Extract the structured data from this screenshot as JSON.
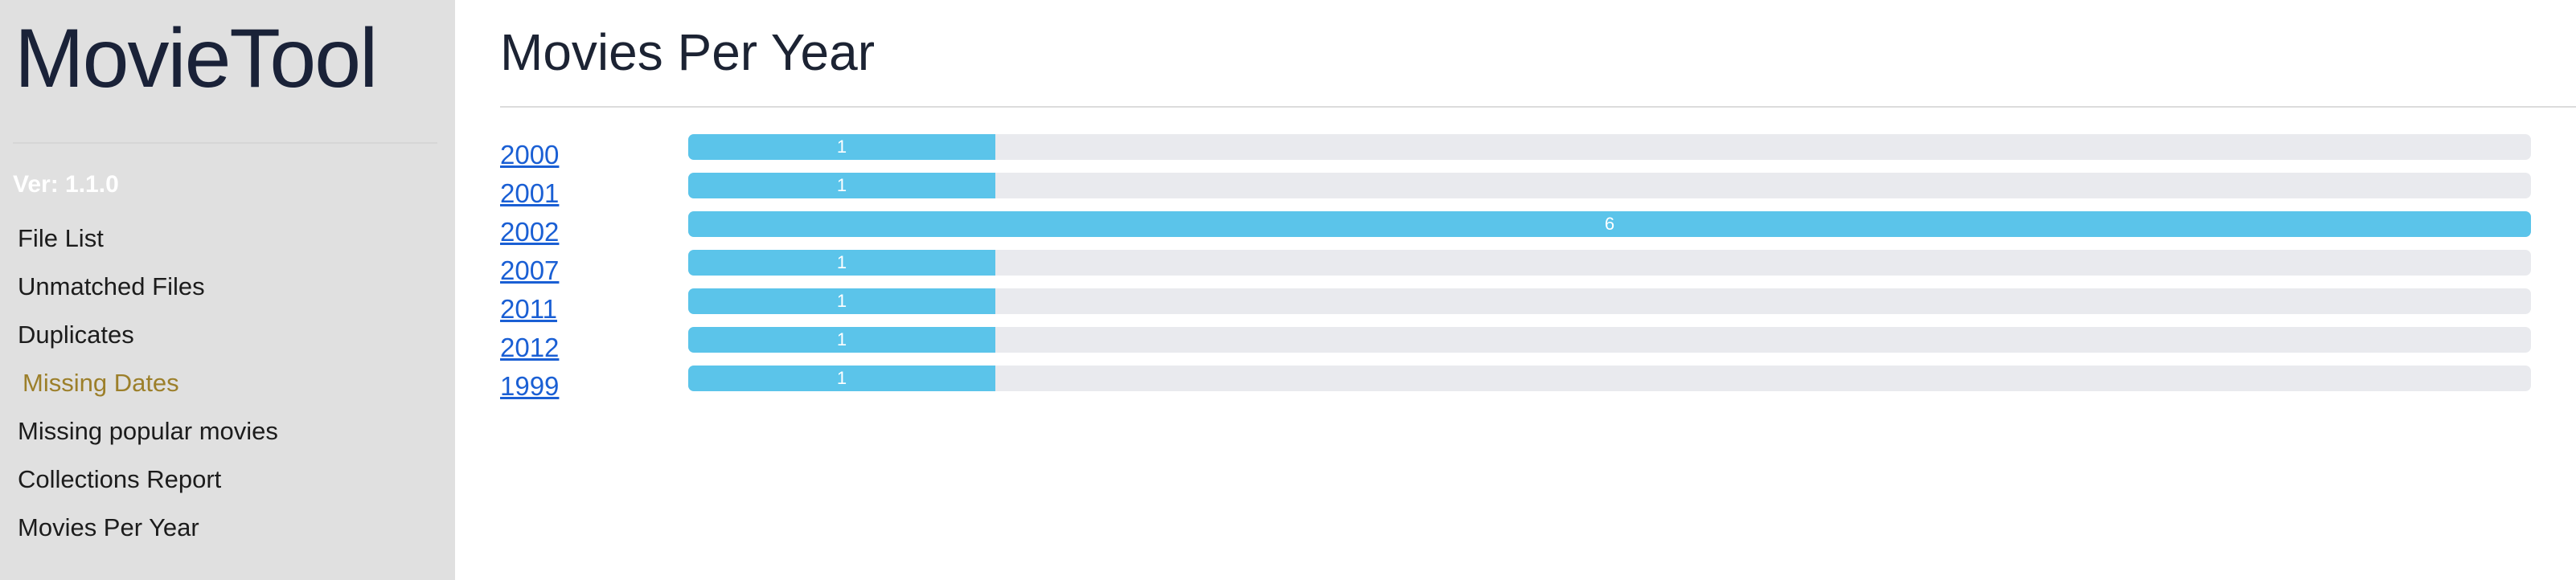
{
  "app": {
    "title": "MovieTool",
    "version": "Ver: 1.1.0"
  },
  "sidebar": {
    "items": [
      {
        "label": "File List",
        "active": false
      },
      {
        "label": "Unmatched Files",
        "active": false
      },
      {
        "label": "Duplicates",
        "active": false
      },
      {
        "label": "Missing Dates",
        "active": true
      },
      {
        "label": "Missing popular movies",
        "active": false
      },
      {
        "label": "Collections Report",
        "active": false
      },
      {
        "label": "Movies Per Year",
        "active": false
      }
    ]
  },
  "main": {
    "title": "Movies Per Year",
    "max_count": 6,
    "rows": [
      {
        "year": "2000",
        "count": 1,
        "count_label": "1"
      },
      {
        "year": "2001",
        "count": 1,
        "count_label": "1"
      },
      {
        "year": "2002",
        "count": 6,
        "count_label": "6"
      },
      {
        "year": "2007",
        "count": 1,
        "count_label": "1"
      },
      {
        "year": "2011",
        "count": 1,
        "count_label": "1"
      },
      {
        "year": "2012",
        "count": 1,
        "count_label": "1"
      },
      {
        "year": "1999",
        "count": 1,
        "count_label": "1"
      }
    ]
  },
  "colors": {
    "sidebar_bg": "#e0e0e0",
    "active_nav": "#9c7f2a",
    "link": "#1a5fd4",
    "bar_fill": "#5bc4ea",
    "bar_track": "#e9eaee"
  }
}
